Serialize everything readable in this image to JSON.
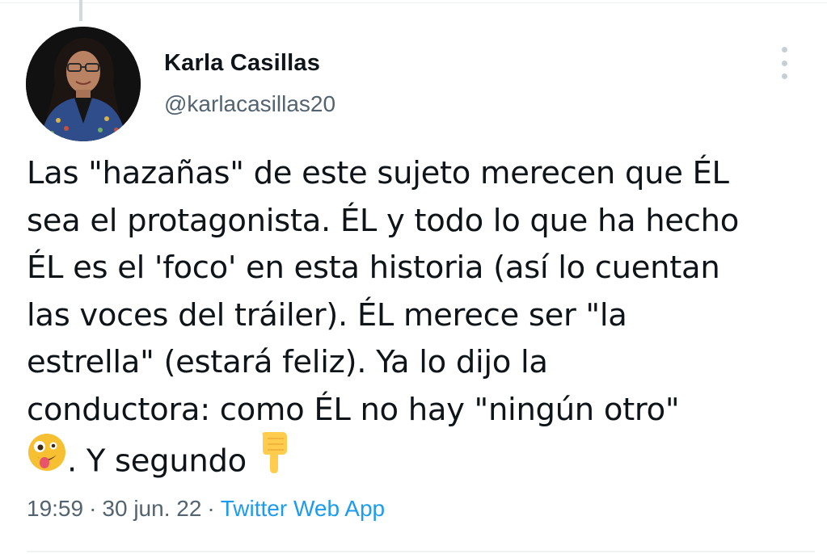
{
  "tweet": {
    "author_name": "Karla Casillas",
    "author_handle": "@karlacasillas20",
    "text_lines": [
      "Las \"hazañas\" de este sujeto merecen que ÉL",
      "sea el protagonista. ÉL y todo lo que ha hecho",
      "ÉL es el 'foco' en esta historia (así lo cuentan",
      "las voces del tráiler). ÉL merece ser \"la",
      "estrella\" (estará feliz). Ya lo dijo la",
      "conductora: como ÉL no hay \"ningún otro\"",
      ". Y segundo"
    ],
    "emojis": [
      "zany-face-emoji",
      "pointing-down-emoji"
    ],
    "time": "19:59",
    "separator": "·",
    "date": "30 jun. 22",
    "source": "Twitter Web App"
  },
  "colors": {
    "text": "#0f1419",
    "secondary": "#536471",
    "link": "#1d9bf0",
    "divider": "#eff3f4",
    "more_dots": "#c4cfd6"
  },
  "icons": {
    "more": "more-options-icon"
  }
}
